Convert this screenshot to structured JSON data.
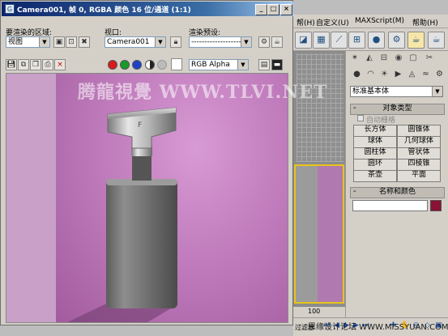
{
  "window": {
    "title": "Camera001, 帧 0, RGBA 颜色 16 位/通道 (1:1)",
    "minimize_label": "_",
    "maximize_label": "□",
    "close_label": "×"
  },
  "toolbar1": {
    "area_label": "要渲染的区域:",
    "area_value": "视图",
    "viewport_label": "视口:",
    "viewport_value": "Camera001",
    "preset_label": "渲染预设:",
    "preset_value": "-------------------------"
  },
  "toolbar2": {
    "channel_value": "RGB Alpha"
  },
  "render": {
    "watermark": "腾龍視覺 WWW.TLVI.NET"
  },
  "max_menu": {
    "items": [
      "帮(H)",
      "自定义(U)",
      "MAXScript(M)",
      "帮助(H)"
    ]
  },
  "command_panel": {
    "category": "标准基本体",
    "object_type_header": "对象类型",
    "auto_grid": "自动栅格",
    "buttons": [
      "长方体",
      "圆锥体",
      "球体",
      "几何球体",
      "圆柱体",
      "管状体",
      "圆环",
      "四棱锥",
      "茶壶",
      "平面"
    ],
    "name_color_header": "名称和颜色",
    "name_value": ""
  },
  "timeline": {
    "frame": "100",
    "filter_label": "过滤器"
  },
  "footer": {
    "watermark": "思缘设计论坛 WWW.MISSYUAN.COM"
  },
  "colors": {
    "title_bar": "#0b246a",
    "render_bg": "#c07cbc",
    "object_color": "#8a1234",
    "viewport_highlight": "#e8c31a"
  },
  "icons": [
    "app-icon",
    "save-icon",
    "copy-icon",
    "clone-icon",
    "print-icon",
    "clear-icon",
    "lock-icon",
    "red-channel-icon",
    "green-channel-icon",
    "blue-channel-icon",
    "alpha-channel-icon",
    "mono-icon",
    "display-channel-icon"
  ]
}
